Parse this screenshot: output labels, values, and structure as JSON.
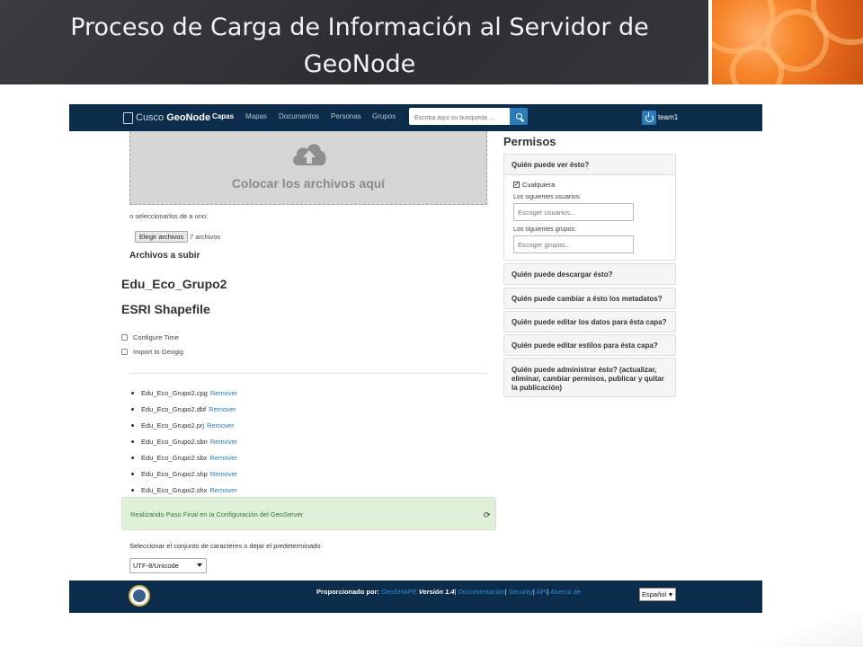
{
  "slide": {
    "title_line1": "Proceso de Carga de Información al Servidor de",
    "title_line2": "GeoNode"
  },
  "navbar": {
    "brand_prefix": "Cusco",
    "brand_name": "GeoNode",
    "items": [
      {
        "label": "Capas",
        "active": true
      },
      {
        "label": "Mapas",
        "active": false
      },
      {
        "label": "Documentos",
        "active": false
      },
      {
        "label": "Personas",
        "active": false
      },
      {
        "label": "Grupos",
        "active": false
      }
    ],
    "search_placeholder": "Escriba aquí su busqueda ...",
    "user": "team1"
  },
  "upload": {
    "drop_text": "Colocar los archivos aquí",
    "select_each": "o seleccionarlos de a uno:",
    "choose_button": "Elegir archivos",
    "file_count": "7 archivos",
    "files_heading": "Archivos a subir",
    "layer_name": "Edu_Eco_Grupo2",
    "layer_type": "ESRI Shapefile",
    "options": [
      "Configure Time",
      "Import to Geogig"
    ],
    "files": [
      "Edu_Eco_Grupo2.cpg",
      "Edu_Eco_Grupo2.dbf",
      "Edu_Eco_Grupo2.prj",
      "Edu_Eco_Grupo2.sbn",
      "Edu_Eco_Grupo2.sbx",
      "Edu_Eco_Grupo2.shp",
      "Edu_Eco_Grupo2.shx"
    ],
    "remove_label": "Remover",
    "status": "Realizando Paso Final en la Configuración del GeoServer",
    "charset_label": "Seleccionar el conjunto de caracteres o dejar el predeterminado",
    "charset_value": "UTF-8/Unicode"
  },
  "permissions": {
    "title": "Permisos",
    "view_heading": "Quién puede ver ésto?",
    "anyone_label": "Cualquiera",
    "users_label": "Los siguientes usuarios:",
    "users_placeholder": "Escoger usuarios...",
    "groups_label": "Los siguientes grupos:",
    "groups_placeholder": "Escoger grupos...",
    "other_headings": [
      "Quién puede descargar ésto?",
      "Quién puede cambiar a ésto los metadatos?",
      "Quién puede editar los datos para ésta capa?",
      "Quién puede editar estilos para ésta capa?",
      "Quién puede administrar ésto? (actualizar, eliminar, cambiar permisos, publicar y quitar la publicación)"
    ]
  },
  "footer": {
    "powered_by": "Proporcionado por:",
    "geoshape": "GeoSHAPE",
    "version": "Versión 1.4",
    "links": [
      "Documentación",
      "Security",
      "API",
      "Acerca de"
    ],
    "language": "Español"
  },
  "colors": {
    "navbar": "#0b2c4a",
    "accent": "#2b7bb9",
    "status_bg": "#dff0d8",
    "slide_header": "#2f3234"
  }
}
